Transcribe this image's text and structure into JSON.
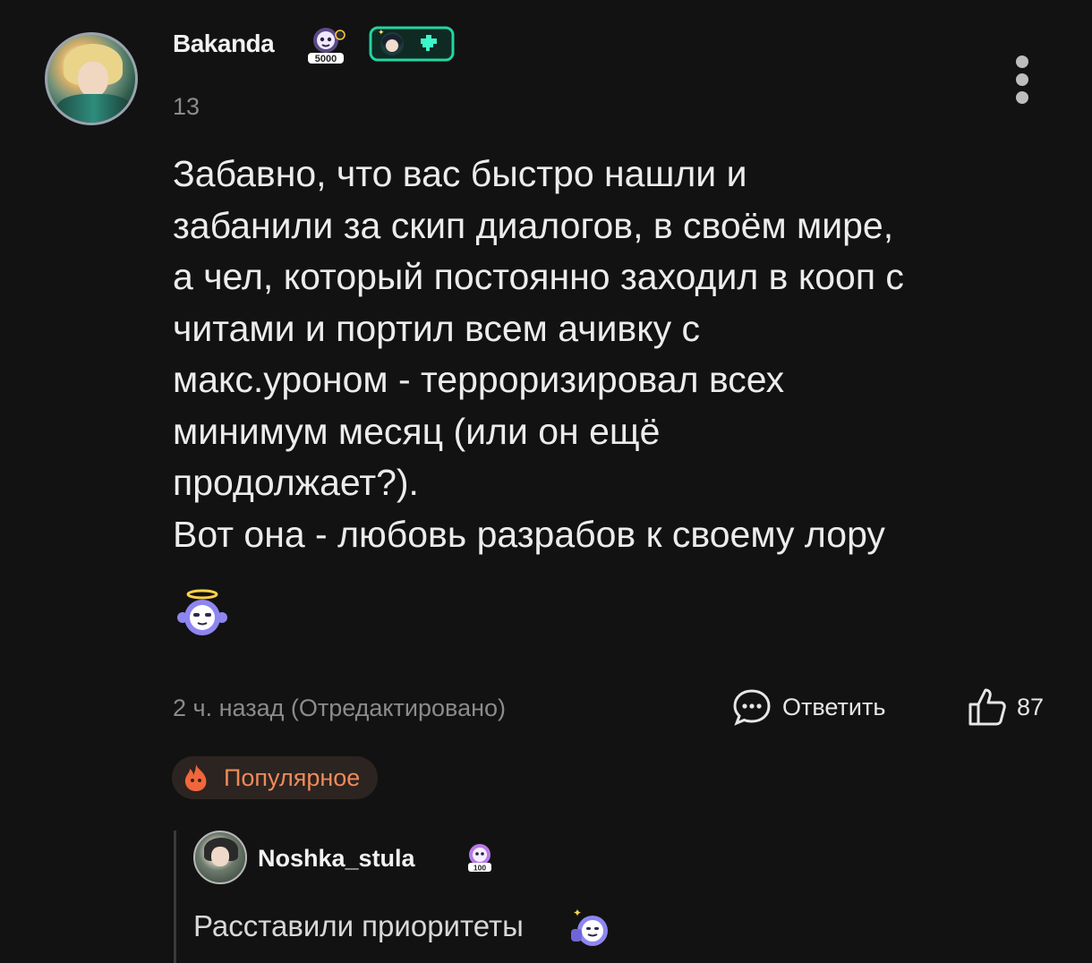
{
  "comment": {
    "username": "Bakanda",
    "level_badge_text": "5000",
    "level": "13",
    "text": "Забавно, что вас быстро нашли и\nзабанили за скип диалогов, в своём мире,\nа чел, который постоянно заходил в кооп с\nчитами и портил всем ачивку с\nмакс.уроном - терроризировал всех\nминимум месяц (или он ещё\nпродолжает?).\nВот она - любовь разрабов к своему лору",
    "time": "2 ч. назад (Отредактировано)",
    "reply_label": "Ответить",
    "likes": "87",
    "popular_label": "Популярное"
  },
  "reply": {
    "username": "Noshka_stula",
    "badge_text": "100",
    "text": "Расставили приоритеты"
  },
  "colors": {
    "background": "#121212",
    "popular_accent": "#f08a5a",
    "badge_frame": "#24d4a4"
  },
  "icons": {
    "more": "more-vertical-icon",
    "reply": "speech-bubble-icon",
    "like": "thumbs-up-icon",
    "popular": "fire-icon"
  }
}
